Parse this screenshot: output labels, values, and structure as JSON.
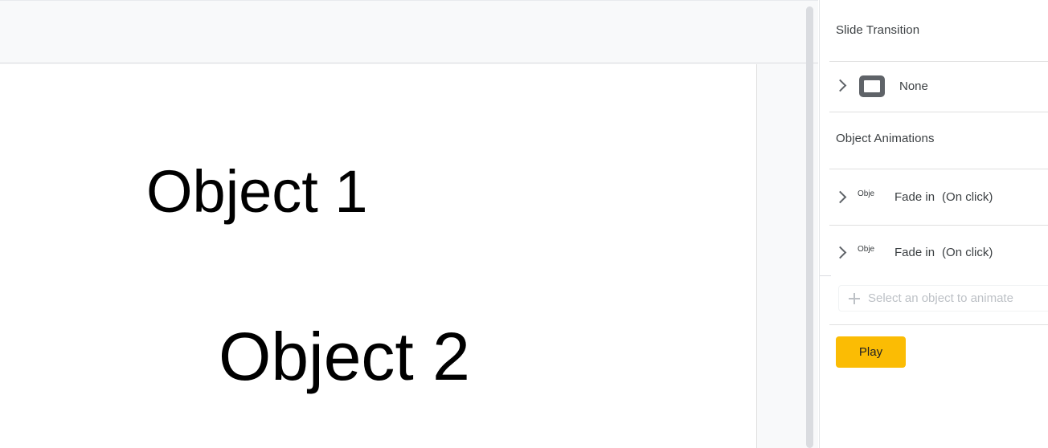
{
  "editor": {
    "slide_objects": [
      {
        "text": "Object 1"
      },
      {
        "text": "Object 2"
      }
    ]
  },
  "panel": {
    "slide_transition": {
      "title": "Slide Transition",
      "chevron_icon": "chevron-right-icon",
      "thumbnail_icon": "slide-rectangle-icon",
      "value": "None"
    },
    "object_animations": {
      "title": "Object Animations",
      "rows": [
        {
          "chevron_icon": "chevron-right-icon",
          "thumbnail_text": "Obje",
          "effect": "Fade in",
          "trigger": "(On click)"
        },
        {
          "chevron_icon": "chevron-right-icon",
          "thumbnail_text": "Obje",
          "effect": "Fade in",
          "trigger": "(On click)"
        }
      ],
      "add_button": {
        "icon": "plus-icon",
        "label": "Select an object to animate"
      }
    },
    "play_button": {
      "label": "Play"
    }
  },
  "colors": {
    "accent_play": "#fbbc04",
    "panel_background": "#ffffff",
    "editor_background": "#f8f9fa",
    "text_primary": "#3c4043",
    "text_disabled": "#bdc1c6",
    "divider": "#e0e0e0"
  }
}
